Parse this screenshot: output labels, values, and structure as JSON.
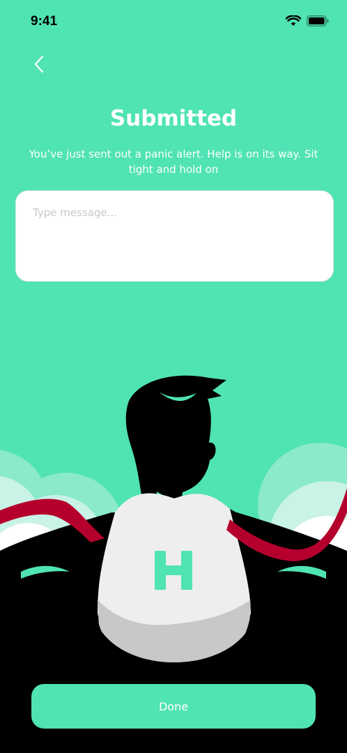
{
  "status_bar": {
    "time": "9:41",
    "icons": [
      "wifi-icon",
      "battery-icon"
    ]
  },
  "nav": {
    "back_icon": "chevron-left-icon"
  },
  "header": {
    "title": "Submitted",
    "subtitle": "You’ve just sent out a panic alert. Help is on its way. Sit tight and hold on"
  },
  "message": {
    "placeholder": "Type message...",
    "value": ""
  },
  "illustration": {
    "description_icon": "superhero-illustration",
    "logo_icon": "h-logo-icon"
  },
  "actions": {
    "done_label": "Done"
  },
  "colors": {
    "accent": "#50E3B4",
    "cape": "#B5002D",
    "white": "#FFFFFF"
  }
}
